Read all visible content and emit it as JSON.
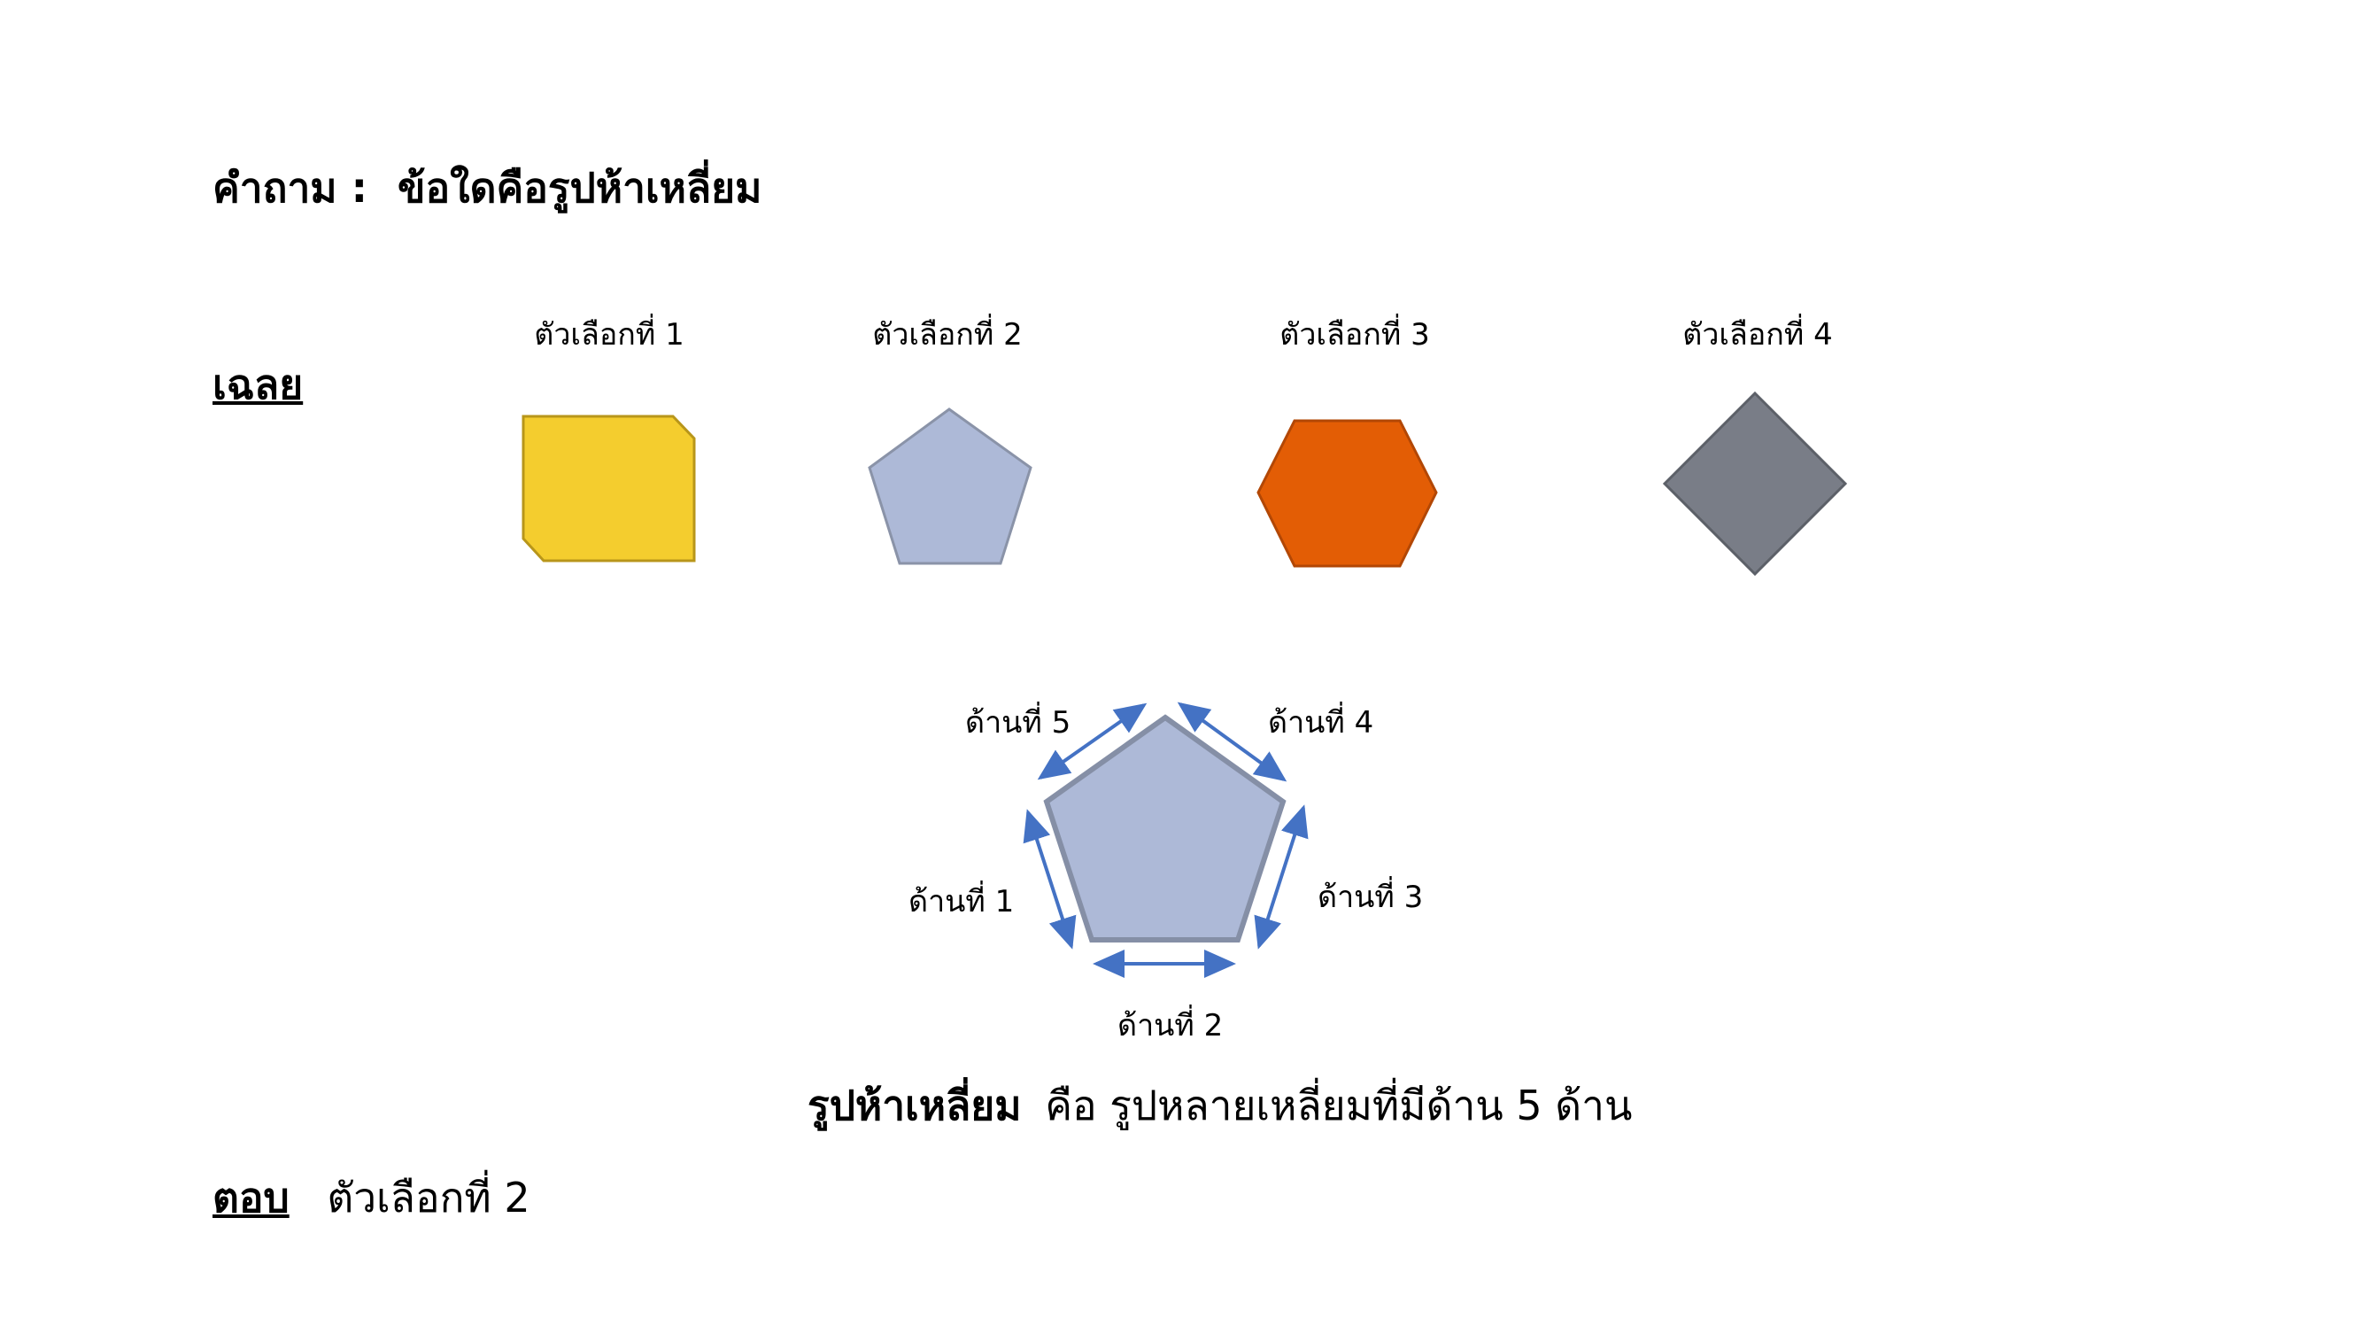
{
  "question": {
    "label": "คำถาม :",
    "text": "ข้อใดคือรูปห้าเหลี่ยม"
  },
  "solution_label": "เฉลย",
  "options": [
    {
      "label": "ตัวเลือกที่ 1",
      "shape": "octagon-like-box",
      "fill": "#F4CD2E",
      "stroke": "#B8961A"
    },
    {
      "label": "ตัวเลือกที่ 2",
      "shape": "pentagon",
      "fill": "#ADB9D7",
      "stroke": "#8A93A8"
    },
    {
      "label": "ตัวเลือกที่ 3",
      "shape": "hexagon",
      "fill": "#E35D05",
      "stroke": "#B24705"
    },
    {
      "label": "ตัวเลือกที่ 4",
      "shape": "diamond",
      "fill": "#797D87",
      "stroke": "#5C6068"
    }
  ],
  "diagram": {
    "shape_fill": "#ADB9D7",
    "shape_stroke": "#858FA6",
    "arrow_color": "#4472C4",
    "sides": [
      "ด้านที่ 1",
      "ด้านที่ 2",
      "ด้านที่ 3",
      "ด้านที่ 4",
      "ด้านที่ 5"
    ]
  },
  "definition": {
    "term": "รูปห้าเหลี่ยม",
    "text": "คือ รูปหลายเหลี่ยมที่มีด้าน 5 ด้าน"
  },
  "answer": {
    "label": "ตอบ",
    "text": "ตัวเลือกที่ 2"
  }
}
